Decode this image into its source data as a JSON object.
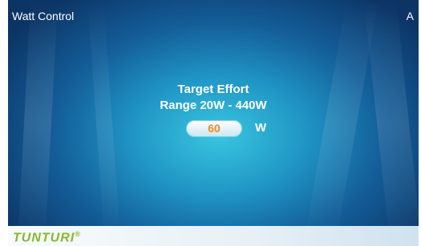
{
  "header": {
    "title": "Watt Control",
    "right_letter": "A"
  },
  "main": {
    "heading": "Target Effort",
    "range_label": "Range 20W - 440W",
    "input_value": "60",
    "unit": "W"
  },
  "footer": {
    "logo_text": "TUNTURI",
    "logo_mark": "®"
  },
  "colors": {
    "accent": "#86b82a",
    "value": "#f28a1f"
  }
}
